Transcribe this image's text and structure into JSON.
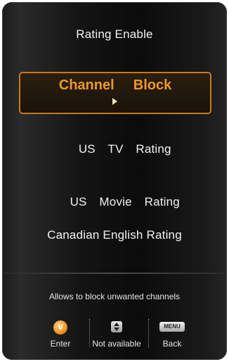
{
  "menu": {
    "items": [
      {
        "label": "Rating Enable"
      },
      {
        "label": "Channel  Block"
      },
      {
        "label": "US  TV  Rating"
      },
      {
        "label": "US  Movie  Rating"
      },
      {
        "label": "Canadian English Rating"
      }
    ],
    "selected_index": 1
  },
  "footer": {
    "help_text": "Allows to block unwanted channels",
    "hints": [
      {
        "icon": "v-button-icon",
        "icon_text": "V",
        "label": "Enter"
      },
      {
        "icon": "up-down-arrows-icon",
        "label": "Not available"
      },
      {
        "icon": "menu-button-icon",
        "icon_text": "MENU",
        "label": "Back"
      }
    ]
  },
  "colors": {
    "accent": "#f0962a",
    "selection_border": "#c77a18",
    "text": "#f2f2f2"
  }
}
